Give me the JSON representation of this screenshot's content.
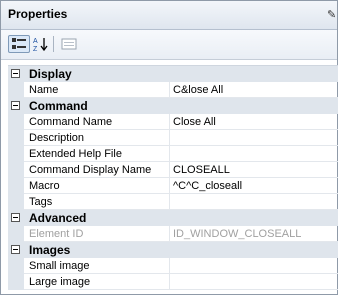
{
  "panel": {
    "title": "Properties"
  },
  "toolbar": {
    "categorized_icon": "categorized-view-icon",
    "alphabetical_icon": "alphabetical-sort-icon",
    "pages_icon": "property-pages-icon"
  },
  "categories": [
    {
      "name": "Display",
      "props": [
        {
          "name": "Name",
          "value": "C&lose All"
        }
      ]
    },
    {
      "name": "Command",
      "props": [
        {
          "name": "Command Name",
          "value": "Close All"
        },
        {
          "name": "Description",
          "value": ""
        },
        {
          "name": "Extended Help File",
          "value": ""
        },
        {
          "name": "Command Display Name",
          "value": "CLOSEALL"
        },
        {
          "name": "Macro",
          "value": "^C^C_closeall"
        },
        {
          "name": "Tags",
          "value": ""
        }
      ]
    },
    {
      "name": "Advanced",
      "props": [
        {
          "name": "Element ID",
          "value": "ID_WINDOW_CLOSEALL",
          "disabled": true
        }
      ]
    },
    {
      "name": "Images",
      "props": [
        {
          "name": "Small image",
          "value": ""
        },
        {
          "name": "Large image",
          "value": ""
        }
      ]
    }
  ]
}
